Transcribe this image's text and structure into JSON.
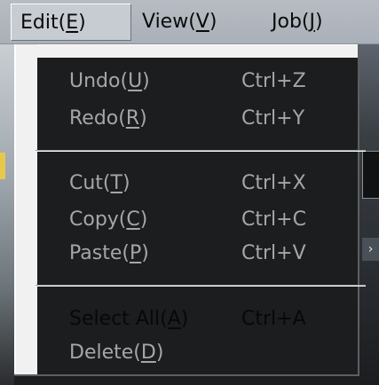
{
  "menubar": {
    "items": [
      {
        "label": "Edit(",
        "mnemonic": "E",
        "suffix": ")",
        "active": true
      },
      {
        "label": "View(",
        "mnemonic": "V",
        "suffix": ")",
        "active": false
      },
      {
        "label": "Job(",
        "mnemonic": "J",
        "suffix": ")",
        "active": false
      }
    ]
  },
  "edit_menu": {
    "items": [
      {
        "label": "Undo(",
        "mnemonic": "U",
        "suffix": ")",
        "shortcut": "Ctrl+Z",
        "enabled": false
      },
      {
        "label": "Redo(",
        "mnemonic": "R",
        "suffix": ")",
        "shortcut": "Ctrl+Y",
        "enabled": false
      },
      {
        "label": "Cut(",
        "mnemonic": "T",
        "suffix": ")",
        "shortcut": "Ctrl+X",
        "enabled": false
      },
      {
        "label": "Copy(",
        "mnemonic": "C",
        "suffix": ")",
        "shortcut": "Ctrl+C",
        "enabled": false
      },
      {
        "label": "Paste(",
        "mnemonic": "P",
        "suffix": ")",
        "shortcut": "Ctrl+V",
        "enabled": false
      },
      {
        "label": "Select All(",
        "mnemonic": "A",
        "suffix": ")",
        "shortcut": "Ctrl+A",
        "enabled": true
      },
      {
        "label": "Delete(",
        "mnemonic": "D",
        "suffix": ")",
        "shortcut": "",
        "enabled": false
      }
    ]
  },
  "background": {
    "arrow_glyph": "›"
  },
  "colors": {
    "menubar_bg": "#aab0b8",
    "menu_bg": "#f1f1f1",
    "disabled_text": "#a6a6a6",
    "enabled_text": "#080808"
  }
}
